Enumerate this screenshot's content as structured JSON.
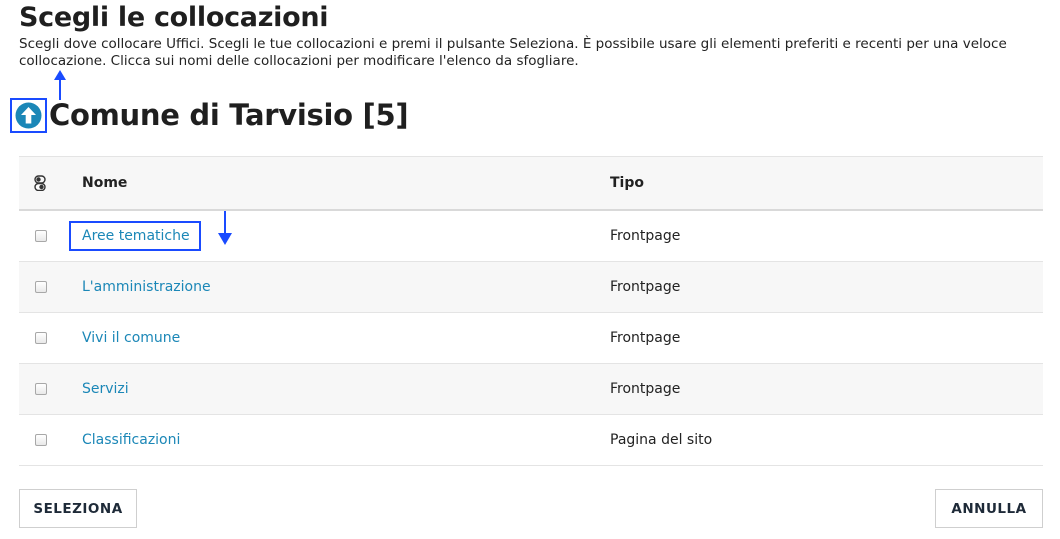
{
  "page": {
    "title": "Scegli le collocazioni",
    "description": "Scegli dove collocare Uffici. Scegli le tue collocazioni e premi il pulsante Seleziona. È possibile usare gli elementi preferiti e recenti per una veloce collocazione. Clicca sui nomi delle collocazioni per modificare l'elenco da sfogliare."
  },
  "browser": {
    "location_title": "Comune di Tarvisio [5]",
    "up_icon": "arrow-up-circle-icon"
  },
  "table": {
    "toggle_icon": "invert-selection-icon",
    "headers": {
      "name": "Nome",
      "type": "Tipo"
    },
    "rows": [
      {
        "name": "Aree tematiche",
        "type": "Frontpage",
        "checked": false
      },
      {
        "name": "L'amministrazione",
        "type": "Frontpage",
        "checked": false
      },
      {
        "name": "Vivi il comune",
        "type": "Frontpage",
        "checked": false
      },
      {
        "name": "Servizi",
        "type": "Frontpage",
        "checked": false
      },
      {
        "name": "Classificazioni",
        "type": "Pagina del sito",
        "checked": false
      }
    ]
  },
  "actions": {
    "select_label": "SELEZIONA",
    "cancel_label": "ANNULLA"
  },
  "colors": {
    "link": "#1b87b7",
    "annotation": "#1a4bff",
    "up_icon": "#1b87b7"
  }
}
